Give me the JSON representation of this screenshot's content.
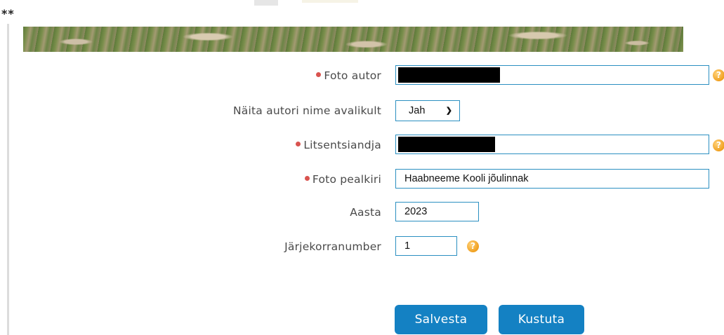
{
  "page": {
    "marker": "**"
  },
  "form": {
    "fields": [
      {
        "label": "Foto autor",
        "required": true,
        "value": "",
        "redacted": true,
        "help": "?"
      },
      {
        "label": "Näita autori nime avalikult",
        "required": false,
        "type": "select",
        "value": "Jah"
      },
      {
        "label": "Litsentsiandja",
        "required": true,
        "value": "",
        "redacted": true,
        "help": "?"
      },
      {
        "label": "Foto pealkiri",
        "required": true,
        "value": "Haabneeme Kooli jõulinnak"
      },
      {
        "label": "Aasta",
        "required": false,
        "value": "2023"
      },
      {
        "label": "Järjekorranumber",
        "required": false,
        "value": "1",
        "help": "?"
      }
    ],
    "required_color": "#d9534f",
    "input_border_color": "#2b8fc1"
  },
  "actions": {
    "save_label": "Salvesta",
    "delete_label": "Kustuta",
    "button_color": "#1481c3"
  }
}
